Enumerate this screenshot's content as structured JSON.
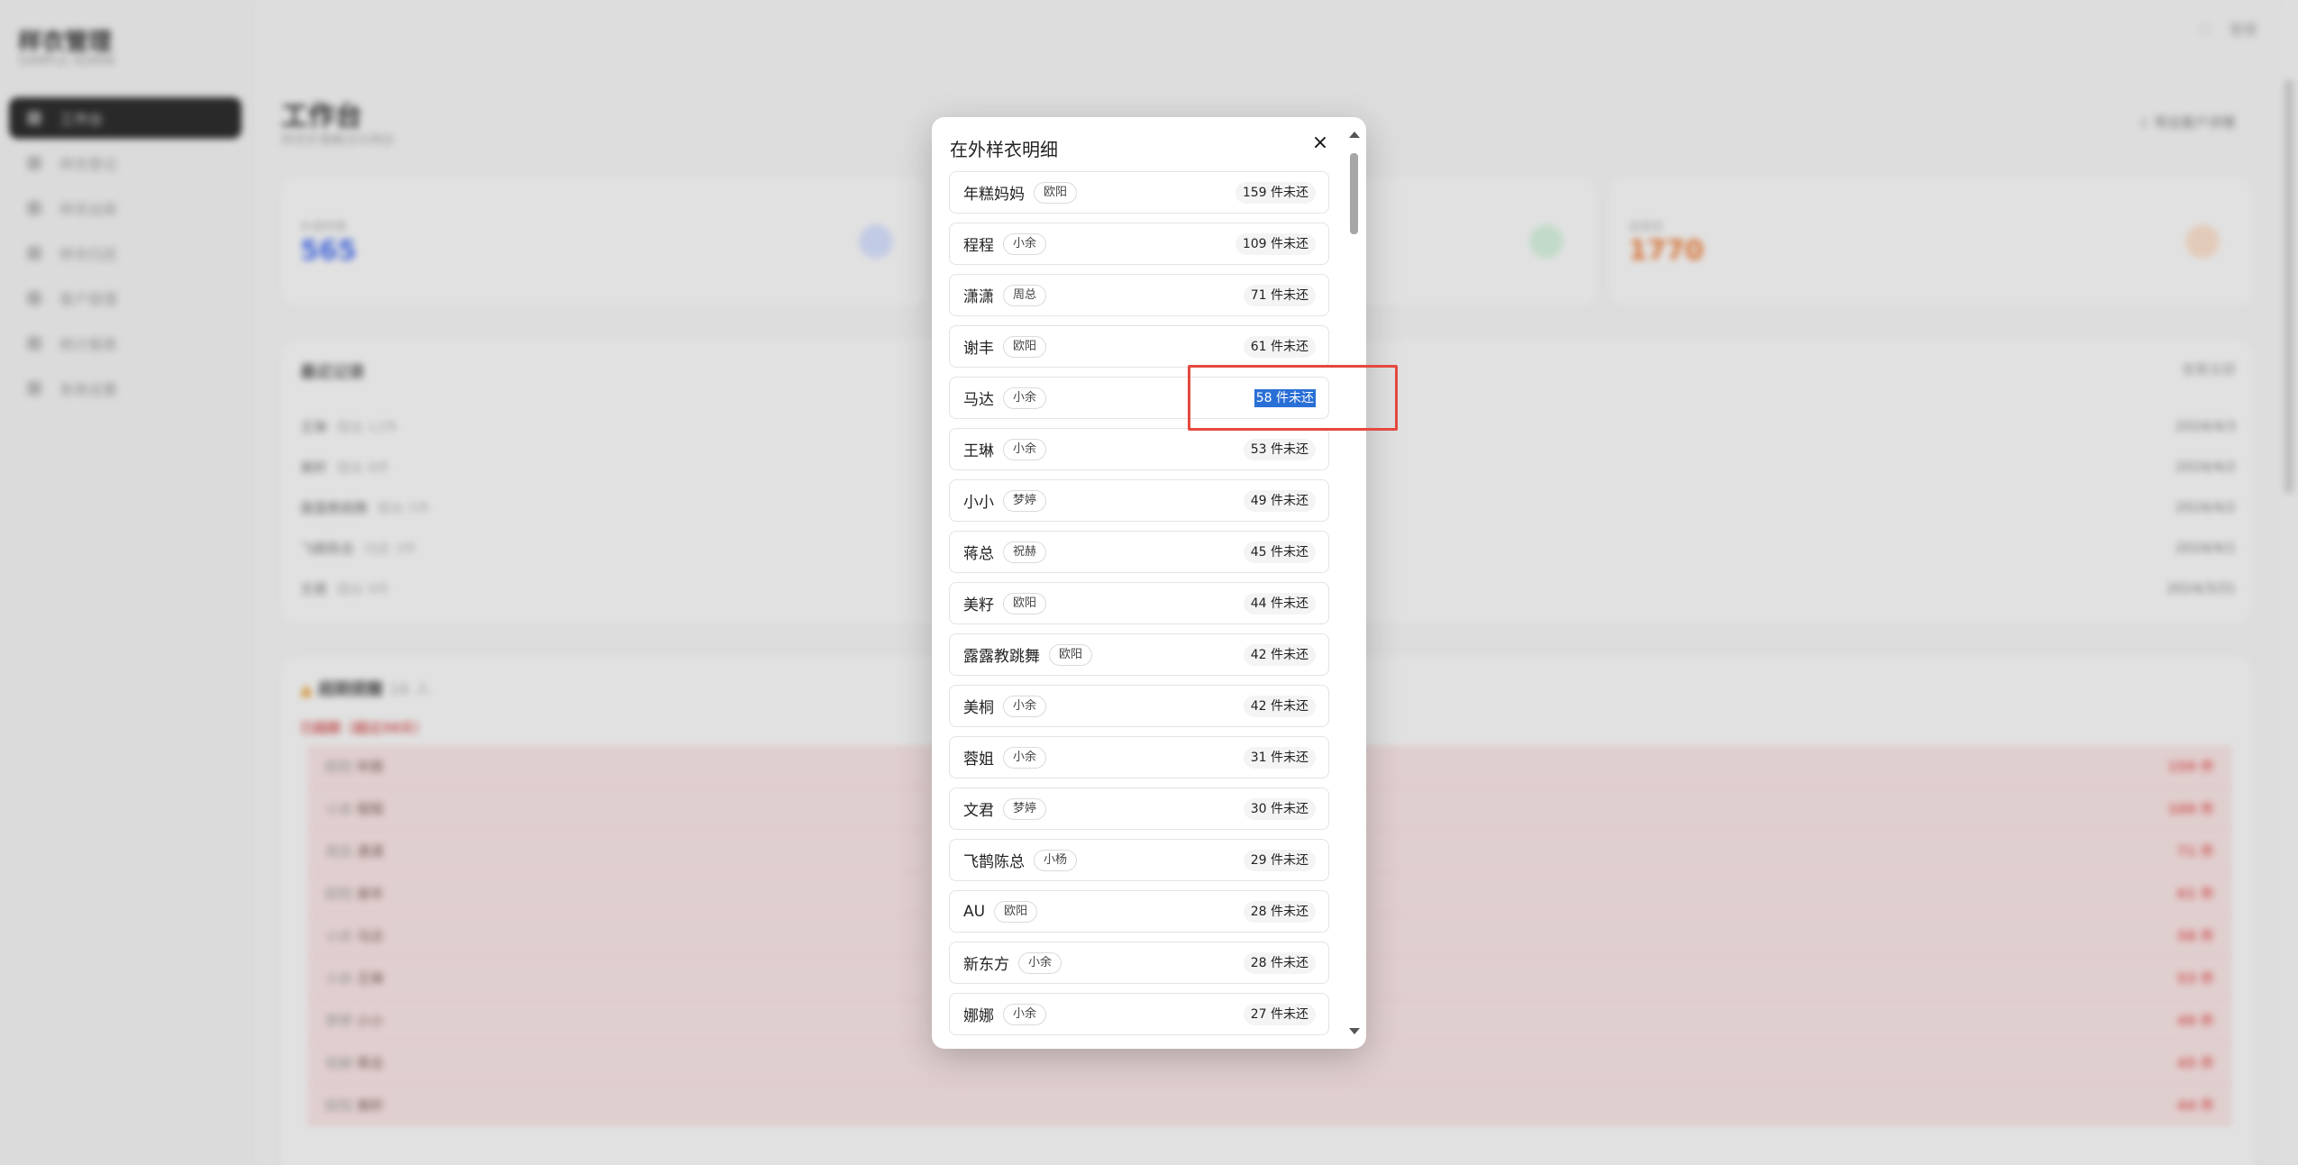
{
  "sidebar": {
    "brand": "样衣管理",
    "brand_sub": "SAMPLE ADMIN",
    "items": [
      {
        "label": "工作台"
      },
      {
        "label": "样衣登记"
      },
      {
        "label": "样衣出库"
      },
      {
        "label": "样衣归还"
      },
      {
        "label": "客户管理"
      },
      {
        "label": "统计报表"
      },
      {
        "label": "系统设置"
      }
    ]
  },
  "topbar": {
    "user": "管理"
  },
  "header": {
    "title": "工作台",
    "subtitle": "样衣外借概况与待办",
    "export_label": "导出客户详情"
  },
  "stats": [
    {
      "label": "外借件数",
      "value": "565",
      "color": "#4a6fe6"
    },
    {
      "label": "",
      "value": "",
      "color": "#4db06a"
    },
    {
      "label": "总库存",
      "value": "1770",
      "color": "#e27a3a"
    }
  ],
  "records": {
    "title": "最近记录",
    "more": "查看全部",
    "rows": [
      {
        "name": "王琳",
        "meta": "借出 12件",
        "right": "2024/4/3"
      },
      {
        "name": "美籽",
        "meta": "借出 8件",
        "right": "2024/4/2"
      },
      {
        "name": "露露教跳舞",
        "meta": "借出 5件",
        "right": "2024/4/2"
      },
      {
        "name": "飞鹊陈总",
        "meta": "归还 3件",
        "right": "2024/4/1"
      },
      {
        "name": "文君",
        "meta": "借出 9件",
        "right": "2024/3/31"
      }
    ]
  },
  "warnings": {
    "title": "超期提醒",
    "count": "16 人",
    "sub": "已超期（超过30天）",
    "rows": [
      {
        "tag": "欧阳",
        "name": "年糕",
        "amt": "159 件"
      },
      {
        "tag": "小余",
        "name": "程程",
        "amt": "109 件"
      },
      {
        "tag": "周总",
        "name": "潇潇",
        "amt": "71 件"
      },
      {
        "tag": "欧阳",
        "name": "谢丰",
        "amt": "61 件"
      },
      {
        "tag": "小余",
        "name": "马达",
        "amt": "58 件"
      },
      {
        "tag": "小余",
        "name": "王琳",
        "amt": "53 件"
      },
      {
        "tag": "梦婷",
        "name": "小小",
        "amt": "49 件"
      },
      {
        "tag": "祝赫",
        "name": "蒋总",
        "amt": "45 件"
      },
      {
        "tag": "欧阳",
        "name": "美籽",
        "amt": "44 件"
      }
    ]
  },
  "modal": {
    "title": "在外样衣明细",
    "close_label": "×",
    "items": [
      {
        "name": "年糕妈妈",
        "owner": "欧阳",
        "count": "159 件未还"
      },
      {
        "name": "程程",
        "owner": "小余",
        "count": "109 件未还"
      },
      {
        "name": "潇潇",
        "owner": "周总",
        "count": "71 件未还"
      },
      {
        "name": "谢丰",
        "owner": "欧阳",
        "count": "61 件未还"
      },
      {
        "name": "马达",
        "owner": "小余",
        "count": "58 件未还",
        "selected": true
      },
      {
        "name": "王琳",
        "owner": "小余",
        "count": "53 件未还"
      },
      {
        "name": "小小",
        "owner": "梦婷",
        "count": "49 件未还"
      },
      {
        "name": "蒋总",
        "owner": "祝赫",
        "count": "45 件未还"
      },
      {
        "name": "美籽",
        "owner": "欧阳",
        "count": "44 件未还"
      },
      {
        "name": "露露教跳舞",
        "owner": "欧阳",
        "count": "42 件未还"
      },
      {
        "name": "美桐",
        "owner": "小余",
        "count": "42 件未还"
      },
      {
        "name": "蓉姐",
        "owner": "小余",
        "count": "31 件未还"
      },
      {
        "name": "文君",
        "owner": "梦婷",
        "count": "30 件未还"
      },
      {
        "name": "飞鹊陈总",
        "owner": "小杨",
        "count": "29 件未还"
      },
      {
        "name": "AU",
        "owner": "欧阳",
        "count": "28 件未还"
      },
      {
        "name": "新东方",
        "owner": "小余",
        "count": "28 件未还"
      },
      {
        "name": "娜娜",
        "owner": "小余",
        "count": "27 件未还"
      }
    ]
  },
  "highlight_color": "#e5483f"
}
